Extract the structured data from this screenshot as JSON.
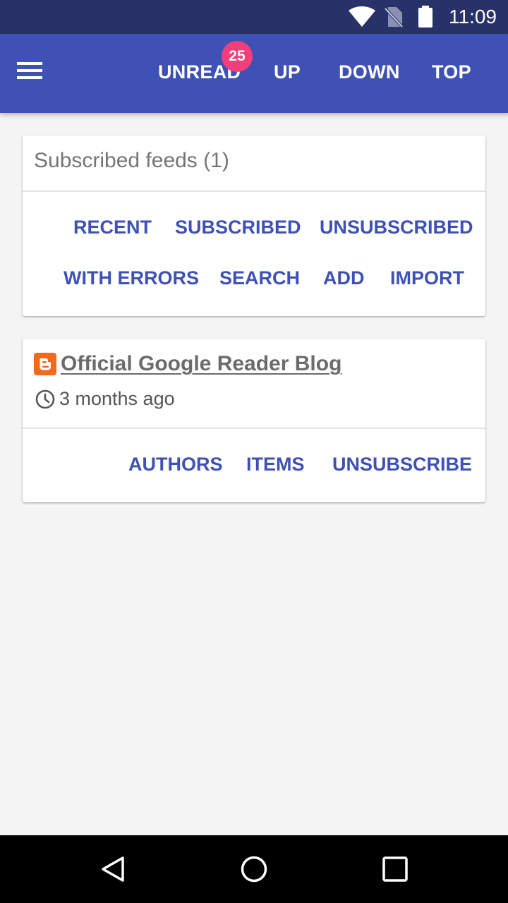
{
  "status_bar": {
    "time": "11:09",
    "icons": [
      "wifi-icon",
      "no-sim-icon",
      "battery-icon"
    ]
  },
  "app_bar": {
    "menu_icon": "hamburger-menu-icon",
    "nav": {
      "unread": "UNREAD",
      "unread_badge": "25",
      "up": "UP",
      "down": "DOWN",
      "top": "TOP"
    }
  },
  "feeds_card": {
    "title": "Subscribed feeds (1)",
    "actions_row1": [
      "RECENT",
      "SUBSCRIBED",
      "UNSUBSCRIBED"
    ],
    "actions_row2": [
      "WITH ERRORS",
      "SEARCH",
      "ADD",
      "IMPORT"
    ]
  },
  "feed_item": {
    "source_icon": "blogger-icon",
    "title": "Official Google Reader Blog",
    "time_icon": "clock-icon",
    "updated": "3 months ago",
    "actions": [
      "AUTHORS",
      "ITEMS",
      "UNSUBSCRIBE"
    ]
  },
  "system_nav": {
    "icons": [
      "back-icon",
      "home-icon",
      "recents-icon"
    ]
  },
  "colors": {
    "primary": "#3f51b5",
    "primary_dark": "#283269",
    "badge": "#f23e7b",
    "blogger_orange": "#f26b1d",
    "background": "#f4f4f4"
  }
}
